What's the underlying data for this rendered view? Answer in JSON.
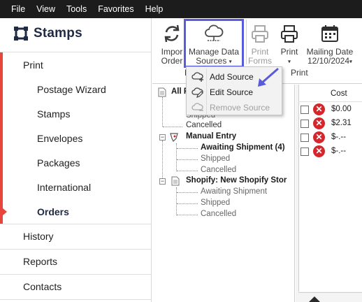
{
  "menu": [
    "File",
    "View",
    "Tools",
    "Favorites",
    "Help"
  ],
  "app": {
    "name": "Stamps"
  },
  "sidebar": {
    "print_label": "Print",
    "print_items": [
      "Postage Wizard",
      "Stamps",
      "Envelopes",
      "Packages",
      "International",
      "Orders"
    ],
    "active_item": "Orders",
    "other_items": [
      "History",
      "Reports",
      "Contacts"
    ]
  },
  "ribbon": {
    "import_label_1": "Impor",
    "import_label_2": "Order",
    "manage_label_1": "Manage Data",
    "manage_label_2": "Sources",
    "print_forms_1": "Print",
    "print_forms_2": "Forms",
    "print_label": "Print",
    "mailing_date_label": "Mailing Date",
    "mailing_date_value": "12/10/2024",
    "group_label_left": "P",
    "group_label_print": "Print"
  },
  "dropdown": {
    "items": [
      {
        "label": "Add Source",
        "enabled": true
      },
      {
        "label": "Edit Source",
        "enabled": true
      },
      {
        "label": "Remove Source",
        "enabled": false
      }
    ]
  },
  "tree": {
    "all_label": "All P",
    "partial_shipped": "Shipped",
    "cancelled_1": "Cancelled",
    "manual_entry": "Manual Entry",
    "awaiting_shipment_4": "Awaiting Shipment (4)",
    "shipped_2": "Shipped",
    "cancelled_2": "Cancelled",
    "shopify": "Shopify: New Shopify Stor",
    "awaiting_shipment": "Awaiting Shipment",
    "shipped_3": "Shipped",
    "cancelled_3": "Cancelled"
  },
  "grid": {
    "header_cost": "Cost",
    "rows": [
      "$0.00",
      "$2.31",
      "$-.--",
      "$-.--"
    ]
  },
  "colors": {
    "accent_red": "#e8453c",
    "highlight": "#5a5bd8",
    "delete_red": "#d6262c",
    "menubar": "#1c1c1c"
  }
}
